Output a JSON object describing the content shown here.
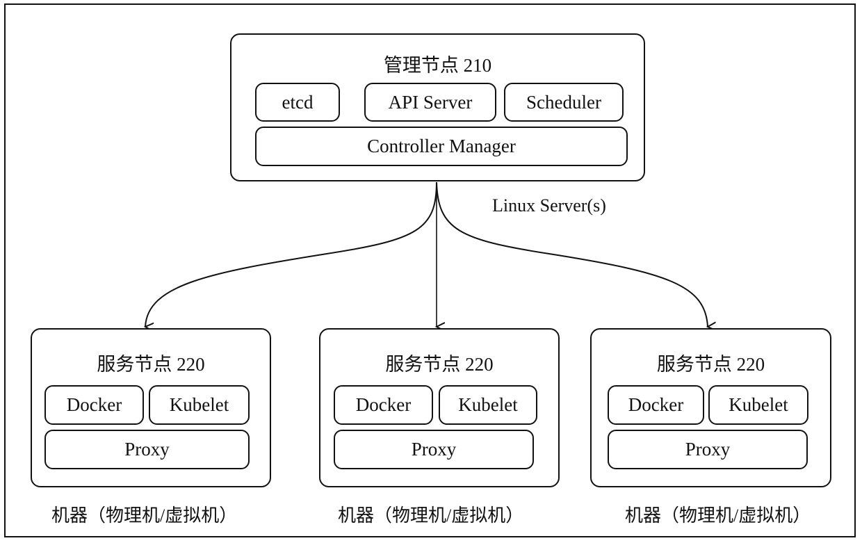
{
  "management_node": {
    "title": "管理节点 210",
    "components": [
      "etcd",
      "API Server",
      "Scheduler"
    ],
    "controller": "Controller Manager"
  },
  "link_label": "Linux Server(s)",
  "service_nodes": [
    {
      "title": "服务节点 220",
      "docker": "Docker",
      "kubelet": "Kubelet",
      "proxy": "Proxy",
      "caption": "机器（物理机/虚拟机）"
    },
    {
      "title": "服务节点 220",
      "docker": "Docker",
      "kubelet": "Kubelet",
      "proxy": "Proxy",
      "caption": "机器（物理机/虚拟机）"
    },
    {
      "title": "服务节点 220",
      "docker": "Docker",
      "kubelet": "Kubelet",
      "proxy": "Proxy",
      "caption": "机器（物理机/虚拟机）"
    }
  ]
}
